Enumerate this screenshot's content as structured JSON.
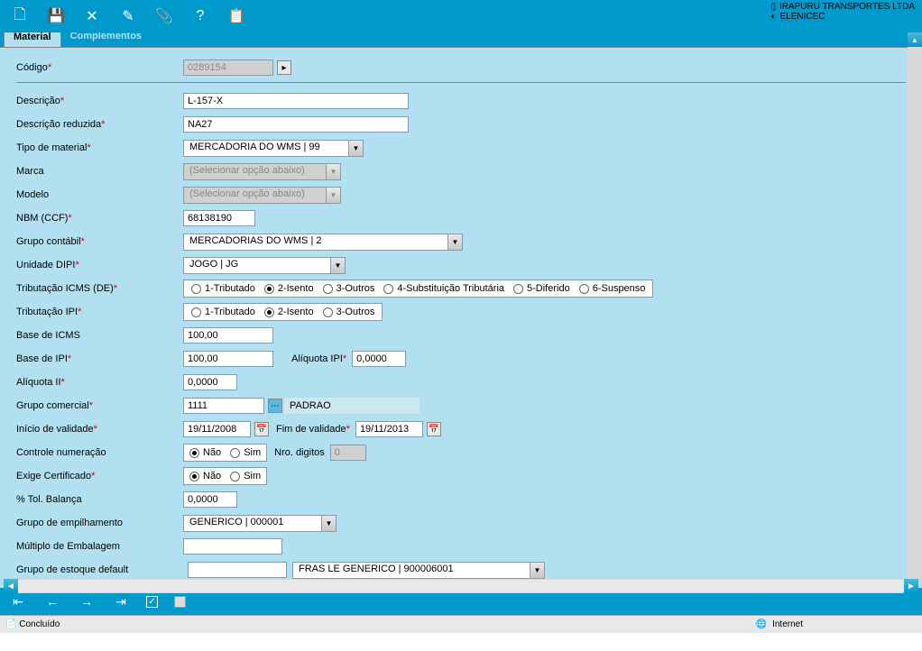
{
  "company": {
    "name": "IRAPURU TRANSPORTES LTDA",
    "user": "ELENICEC"
  },
  "tabs": {
    "material": "Material",
    "complementos": "Complementos"
  },
  "labels": {
    "codigo": "Código",
    "descricao": "Descrição",
    "desc_reduzida": "Descrição reduzida",
    "tipo_material": "Tipo de material",
    "marca": "Marca",
    "modelo": "Modelo",
    "nbm": "NBM (CCF)",
    "grupo_contabil": "Grupo contábil",
    "unidade_dipi": "Unidade DIPI",
    "trib_icms": "Tributação ICMS (DE)",
    "trib_ipi": "Tributação IPI",
    "base_icms": "Base de ICMS",
    "base_ipi": "Base de IPI",
    "aliquota_ipi": "Alíquota IPI",
    "aliquota_ii": "Alíquota II",
    "grupo_comercial": "Grupo comercial",
    "inicio_validade": "Início de validade",
    "fim_validade": "Fim de validade",
    "controle_num": "Controle numeração",
    "nro_digitos": "Nro. digitos",
    "exige_cert": "Exige Certificado",
    "tol_balanca": "% Tol. Balança",
    "grupo_empilhamento": "Grupo de empilhamento",
    "multiplo_emb": "Múltiplo de Embalagem",
    "grupo_estoque": "Grupo de estoque default"
  },
  "values": {
    "codigo": "0289154",
    "descricao": "L-157-X",
    "desc_reduzida": "NA27",
    "tipo_material": "MERCADORIA DO WMS | 99",
    "marca": "(Selecionar opção abaixo)",
    "modelo": "(Selecionar opção abaixo)",
    "nbm": "68138190",
    "grupo_contabil": "MERCADORIAS DO WMS | 2",
    "unidade_dipi": "JOGO | JG",
    "base_icms": "100,00",
    "base_ipi": "100,00",
    "aliquota_ipi": "0,0000",
    "aliquota_ii": "0,0000",
    "grupo_comercial": "1111",
    "grupo_comercial_nome": "PADRAO",
    "inicio_validade": "19/11/2008",
    "fim_validade": "19/11/2013",
    "nro_digitos": "0",
    "tol_balanca": "0,0000",
    "grupo_empilhamento": "GENERICO | 000001",
    "multiplo_emb": "",
    "grupo_estoque_cod": "",
    "grupo_estoque": "FRAS LE GENERICO | 900006001"
  },
  "radio": {
    "icms": [
      "1-Tributado",
      "2-Isento",
      "3-Outros",
      "4-Substituição Tributária",
      "5-Diferido",
      "6-Suspenso"
    ],
    "ipi": [
      "1-Tributado",
      "2-Isento",
      "3-Outros"
    ],
    "nao_sim": [
      "Não",
      "Sim"
    ]
  },
  "status": {
    "left": "Concluído",
    "right": "Internet"
  }
}
